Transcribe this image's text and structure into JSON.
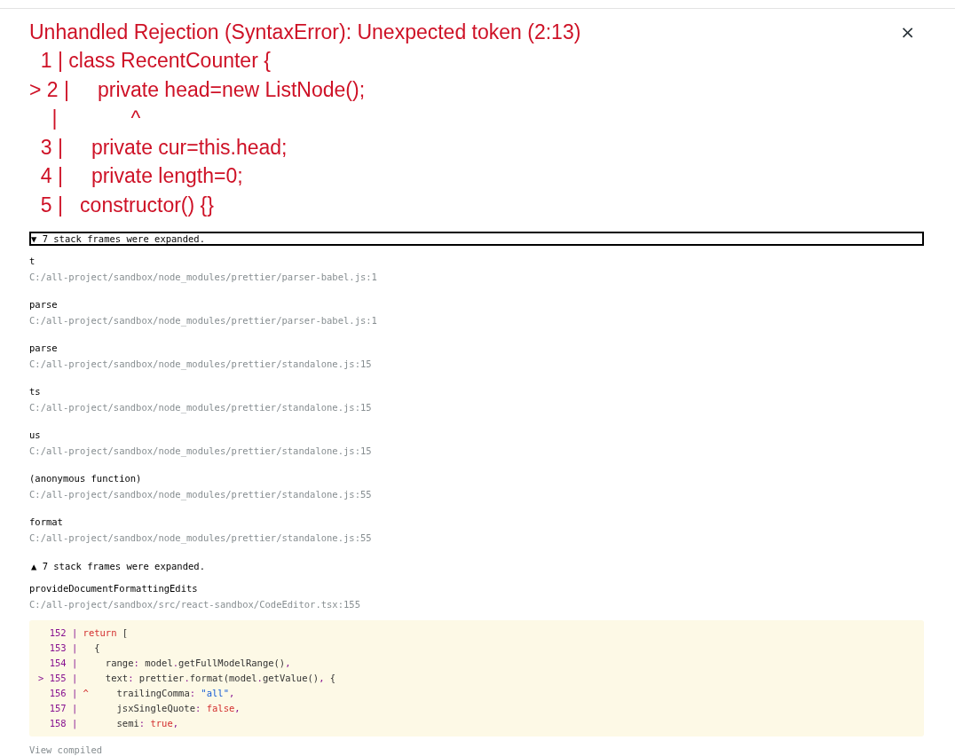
{
  "header": {
    "title": "Unhandled Rejection (SyntaxError): Unexpected token (2:13)",
    "close": "×"
  },
  "source_lines": [
    "  1 | class RecentCounter {",
    "> 2 |     private head=new ListNode();",
    "    |             ^",
    "  3 |     private cur=this.head;",
    "  4 |     private length=0;",
    "  5 |   constructor() {}"
  ],
  "collapsed_toggle": {
    "label": "▼ 7 stack frames were expanded.",
    "focused": true
  },
  "frames": [
    {
      "name": "t",
      "file": "C:/all-project/sandbox/node_modules/prettier/parser-babel.js:1"
    },
    {
      "name": "parse",
      "file": "C:/all-project/sandbox/node_modules/prettier/parser-babel.js:1"
    },
    {
      "name": "parse",
      "file": "C:/all-project/sandbox/node_modules/prettier/standalone.js:15"
    },
    {
      "name": "ts",
      "file": "C:/all-project/sandbox/node_modules/prettier/standalone.js:15"
    },
    {
      "name": "us",
      "file": "C:/all-project/sandbox/node_modules/prettier/standalone.js:15"
    },
    {
      "name": "(anonymous function)",
      "file": "C:/all-project/sandbox/node_modules/prettier/standalone.js:55"
    },
    {
      "name": "format",
      "file": "C:/all-project/sandbox/node_modules/prettier/standalone.js:55"
    }
  ],
  "expanded_toggle": {
    "label": "▲ 7 stack frames were expanded.",
    "focused": false
  },
  "source_frame": {
    "name": "provideDocumentFormattingEdits",
    "file": "C:/all-project/sandbox/src/react-sandbox/CodeEditor.tsx:155",
    "lines": [
      {
        "gutter": "  152 |",
        "tokens": [
          {
            "kind": "keyword",
            "text": " return"
          },
          {
            "kind": "plain",
            "text": " ["
          }
        ]
      },
      {
        "gutter": "  153 |",
        "tokens": [
          {
            "kind": "plain",
            "text": "   {"
          }
        ]
      },
      {
        "gutter": "  154 |",
        "tokens": [
          {
            "kind": "plain",
            "text": "     range"
          },
          {
            "kind": "punct",
            "text": ":"
          },
          {
            "kind": "plain",
            "text": " model"
          },
          {
            "kind": "punct",
            "text": "."
          },
          {
            "kind": "plain",
            "text": "getFullModelRange()"
          },
          {
            "kind": "punct",
            "text": ","
          }
        ]
      },
      {
        "gutter": "> 155 |",
        "tokens": [
          {
            "kind": "plain",
            "text": "     text"
          },
          {
            "kind": "punct",
            "text": ":"
          },
          {
            "kind": "plain",
            "text": " prettier"
          },
          {
            "kind": "punct",
            "text": "."
          },
          {
            "kind": "plain",
            "text": "format(model"
          },
          {
            "kind": "punct",
            "text": "."
          },
          {
            "kind": "plain",
            "text": "getValue()"
          },
          {
            "kind": "punct",
            "text": ","
          },
          {
            "kind": "plain",
            "text": " {"
          }
        ]
      },
      {
        "gutter": "  156 |",
        "tokens": [
          {
            "kind": "caret",
            "text": " ^"
          },
          {
            "kind": "plain",
            "text": "     trailingComma"
          },
          {
            "kind": "punct",
            "text": ":"
          },
          {
            "kind": "string",
            "text": " \"all\""
          },
          {
            "kind": "punct",
            "text": ","
          }
        ]
      },
      {
        "gutter": "  157 |",
        "tokens": [
          {
            "kind": "plain",
            "text": "       jsxSingleQuote"
          },
          {
            "kind": "punct",
            "text": ":"
          },
          {
            "kind": "literal",
            "text": " false"
          },
          {
            "kind": "punct",
            "text": ","
          }
        ]
      },
      {
        "gutter": "  158 |",
        "tokens": [
          {
            "kind": "plain",
            "text": "       semi"
          },
          {
            "kind": "punct",
            "text": ":"
          },
          {
            "kind": "literal",
            "text": " true"
          },
          {
            "kind": "punct",
            "text": ","
          }
        ]
      }
    ],
    "view_compiled": "View compiled"
  }
}
